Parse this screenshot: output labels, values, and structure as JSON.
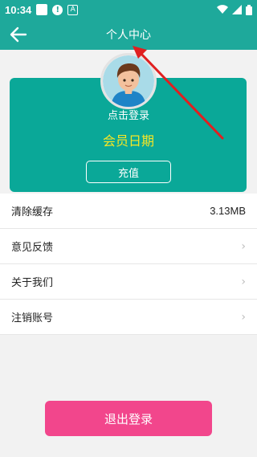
{
  "status_bar": {
    "time": "10:34"
  },
  "app_bar": {
    "title": "个人中心"
  },
  "profile": {
    "login_prompt": "点击登录",
    "member_date_label": "会员日期",
    "recharge_label": "充值"
  },
  "menu": {
    "items": [
      {
        "label": "清除缓存",
        "value": "3.13MB"
      },
      {
        "label": "意见反馈"
      },
      {
        "label": "关于我们"
      },
      {
        "label": "注销账号"
      }
    ]
  },
  "logout": {
    "label": "退出登录"
  },
  "colors": {
    "primary": "#1ea99b",
    "card": "#0aa898",
    "accent_yellow": "#f5e626",
    "logout": "#f2468c",
    "annotation_red": "#e02020"
  }
}
